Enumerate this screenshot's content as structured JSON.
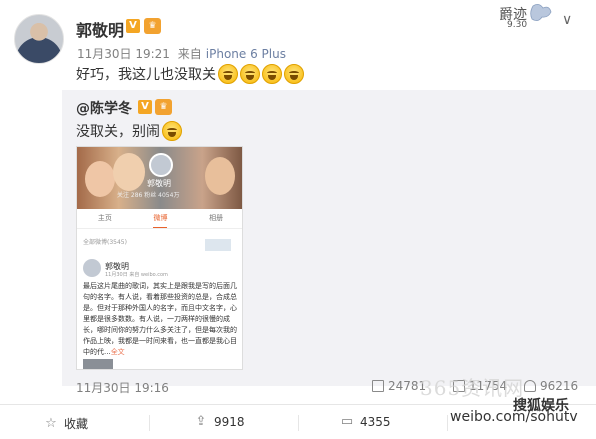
{
  "post": {
    "username": "郭敬明",
    "v_badge": "V",
    "time": "11月30日 19:21",
    "source_prefix": "来自",
    "source": "iPhone 6 Plus",
    "text": "好巧，我这儿也没取关",
    "emojis": [
      "laugh-cry",
      "laugh-cry",
      "laugh-cry",
      "laugh-cry"
    ],
    "deco_date": "9.30"
  },
  "repost": {
    "username": "@陈学冬",
    "v_badge": "V",
    "text": "没取关，别闹",
    "time": "11月30日 19:16",
    "actions": {
      "forward": "24781",
      "comment": "11754",
      "like": "96216"
    },
    "screenshot": {
      "profile_name": "郭敬明",
      "stats": "关注 286  粉丝 4054万",
      "tabs": [
        "主页",
        "微博",
        "相册"
      ],
      "active_tab": "微博",
      "count_label": "全部微博(3545)",
      "inner_user": "郭敬明",
      "inner_sub": "11月30日 来自 weibo.com",
      "inner_text": "最后这片尾曲的歌词，其实上是跟我是写的后面几句的名字。有人说，看着那些投资的总是，合成总是。但对于那种外国人的名字，而且中文名字，心里都是很多数数。有人说，一刀两样的很慢的成长，哪时间你的努力什么多关注了，但是每次我的作品上映，我都是一时间来看，也一直都是我心目中的代...",
      "more": "全文"
    }
  },
  "bottom_bar": {
    "favorite": "收藏",
    "forward": "9918",
    "comment": "4355"
  },
  "watermark": {
    "text1": "365资讯网",
    "text2": "weibo.com/sohutv",
    "text3": "搜狐娱乐"
  },
  "colors": {
    "accent": "#eb7350",
    "source_link": "#6c7fa2",
    "repost_bg": "#f2f2f5",
    "badge": "#f4a623"
  }
}
